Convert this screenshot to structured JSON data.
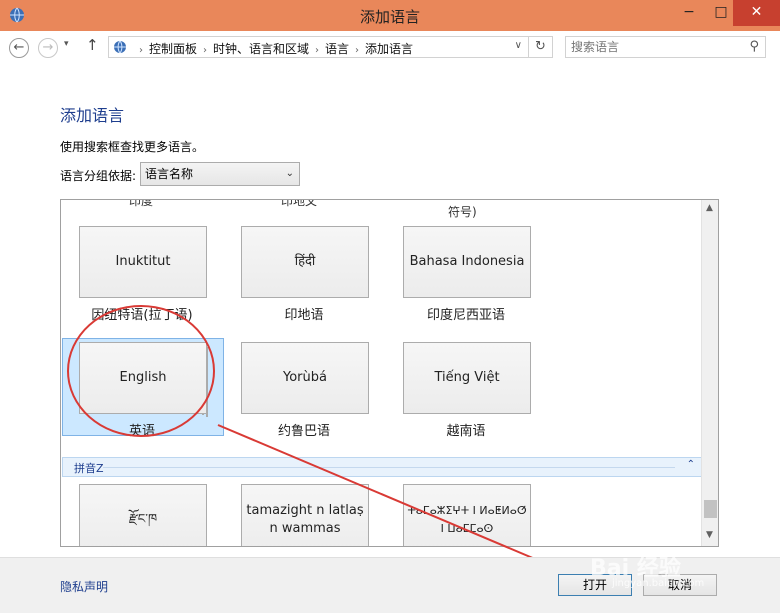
{
  "window": {
    "title": "添加语言",
    "min_glyph": "−",
    "max_glyph": "□",
    "close_glyph": "✕"
  },
  "nav": {
    "back_glyph": "←",
    "forward_glyph": "→",
    "recent_glyph": "▾",
    "up_glyph": "↑",
    "breadcrumb": [
      "控制面板",
      "时钟、语言和区域",
      "语言",
      "添加语言"
    ],
    "separator": "›",
    "dropdown_glyph": "∨",
    "refresh_glyph": "↻",
    "search_placeholder": "搜索语言",
    "search_glyph": "⚲"
  },
  "content": {
    "title": "添加语言",
    "hint": "使用搜索框查找更多语言。",
    "group_label": "语言分组依据:",
    "group_value": "语言名称",
    "group_arrow": "⌄"
  },
  "languages": {
    "partial_top": [
      "印度",
      "印地文",
      "符号)"
    ],
    "tiles": [
      {
        "native": "Inuktitut",
        "name": "因纽特语(拉丁语)"
      },
      {
        "native": "हिंदी",
        "name": "印地语"
      },
      {
        "native": "Bahasa Indonesia",
        "name": "印度尼西亚语"
      },
      {
        "native": "English",
        "name": "英语"
      },
      {
        "native": "Yorùbá",
        "name": "约鲁巴语"
      },
      {
        "native": "Tiếng Việt",
        "name": "越南语"
      }
    ],
    "section": {
      "label": "拼音Z",
      "chevron": "⌃"
    },
    "bottom_tiles": [
      {
        "native": "རྫོང་ཁ"
      },
      {
        "native": "tamazight n latlaṣ n wammas"
      },
      {
        "native": "ⵜⴰⵎⴰⵣⵉⵖⵜ ⵏ ⵍⴰⵟⵍⴰⵚ ⵏ ⵡⴰⵎⵎⴰⵙ"
      }
    ]
  },
  "footer": {
    "privacy": "隐私声明",
    "open": "打开",
    "cancel": "取消"
  },
  "watermark": {
    "text": "Bai 经验",
    "sub": "jingyan.baidu.com"
  },
  "colors": {
    "titlebar": "#e9875a",
    "close": "#c7402f",
    "accent": "#1e3e8e",
    "annotation": "#d93a35"
  }
}
